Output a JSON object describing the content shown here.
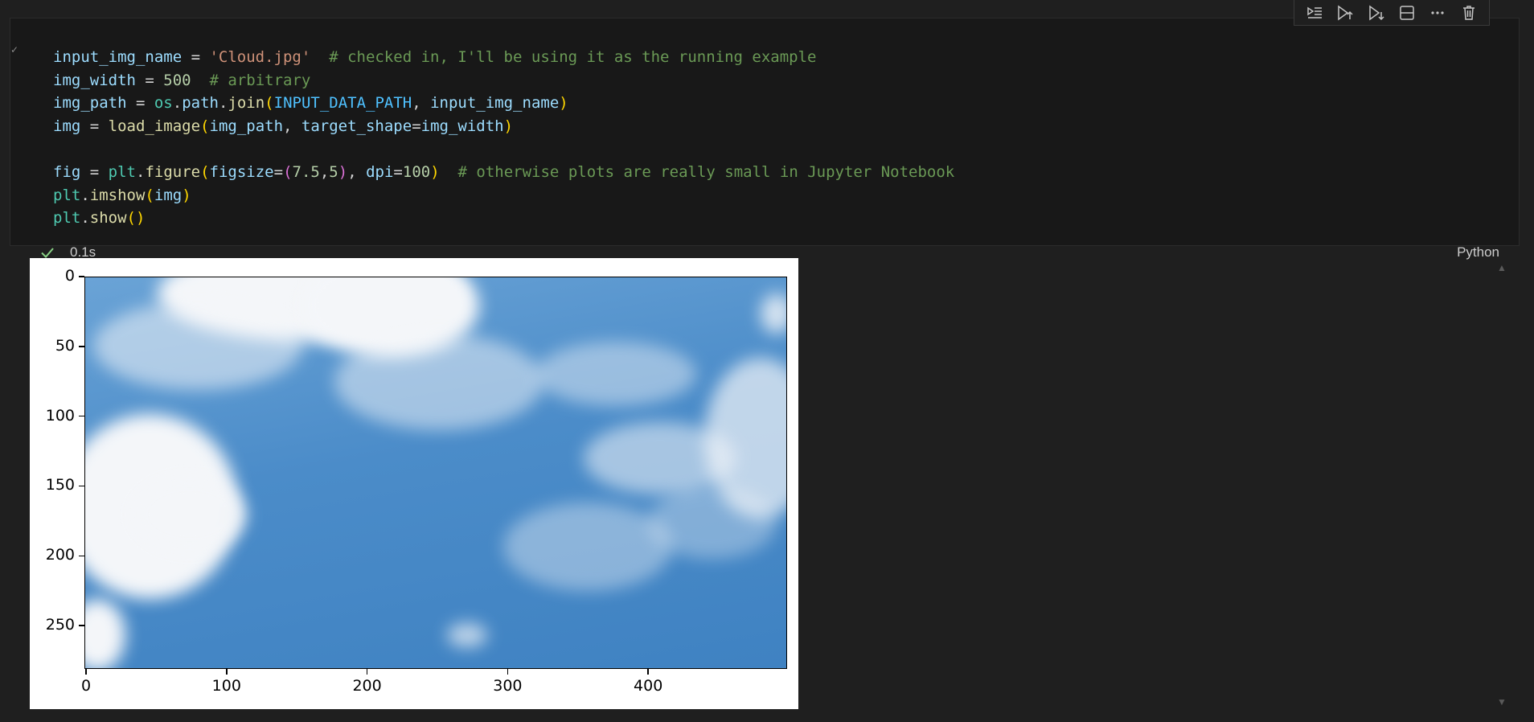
{
  "cell": {
    "code_lines": [
      {
        "tokens": [
          [
            "v",
            "input_img_name"
          ],
          [
            "o",
            " = "
          ],
          [
            "s",
            "'Cloud.jpg'"
          ],
          [
            "o",
            "  "
          ],
          [
            "c",
            "# checked in, I'll be using it as the running example"
          ]
        ]
      },
      {
        "tokens": [
          [
            "v",
            "img_width"
          ],
          [
            "o",
            " = "
          ],
          [
            "n",
            "500"
          ],
          [
            "o",
            "  "
          ],
          [
            "c",
            "# arbitrary"
          ]
        ]
      },
      {
        "tokens": [
          [
            "v",
            "img_path"
          ],
          [
            "o",
            " = "
          ],
          [
            "m",
            "os"
          ],
          [
            "o",
            "."
          ],
          [
            "v",
            "path"
          ],
          [
            "o",
            "."
          ],
          [
            "f",
            "join"
          ],
          [
            "p1",
            "("
          ],
          [
            "k",
            "INPUT_DATA_PATH"
          ],
          [
            "o",
            ", "
          ],
          [
            "v",
            "input_img_name"
          ],
          [
            "p1",
            ")"
          ]
        ]
      },
      {
        "tokens": [
          [
            "v",
            "img"
          ],
          [
            "o",
            " = "
          ],
          [
            "f",
            "load_image"
          ],
          [
            "p1",
            "("
          ],
          [
            "v",
            "img_path"
          ],
          [
            "o",
            ", "
          ],
          [
            "v",
            "target_shape"
          ],
          [
            "o",
            "="
          ],
          [
            "v",
            "img_width"
          ],
          [
            "p1",
            ")"
          ]
        ]
      },
      {
        "tokens": []
      },
      {
        "tokens": [
          [
            "v",
            "fig"
          ],
          [
            "o",
            " = "
          ],
          [
            "m",
            "plt"
          ],
          [
            "o",
            "."
          ],
          [
            "f",
            "figure"
          ],
          [
            "p1",
            "("
          ],
          [
            "v",
            "figsize"
          ],
          [
            "o",
            "="
          ],
          [
            "p2",
            "("
          ],
          [
            "n",
            "7.5"
          ],
          [
            "o",
            ","
          ],
          [
            "n",
            "5"
          ],
          [
            "p2",
            ")"
          ],
          [
            "o",
            ", "
          ],
          [
            "v",
            "dpi"
          ],
          [
            "o",
            "="
          ],
          [
            "n",
            "100"
          ],
          [
            "p1",
            ")"
          ],
          [
            "o",
            "  "
          ],
          [
            "c",
            "# otherwise plots are really small in Jupyter Notebook"
          ]
        ]
      },
      {
        "tokens": [
          [
            "m",
            "plt"
          ],
          [
            "o",
            "."
          ],
          [
            "f",
            "imshow"
          ],
          [
            "p1",
            "("
          ],
          [
            "v",
            "img"
          ],
          [
            "p1",
            ")"
          ]
        ]
      },
      {
        "tokens": [
          [
            "m",
            "plt"
          ],
          [
            "o",
            "."
          ],
          [
            "f",
            "show"
          ],
          [
            "p1",
            "()"
          ]
        ]
      }
    ],
    "exec_time": "0.1s",
    "language": "Python",
    "status_icon": "check-icon"
  },
  "toolbar": {
    "buttons": [
      "run-by-line-icon",
      "execute-above-icon",
      "execute-below-icon",
      "split-cell-icon",
      "more-actions-icon",
      "delete-cell-icon"
    ]
  },
  "output": {
    "image_alt": "Cloud.jpg",
    "y_ticks": [
      "0",
      "50",
      "100",
      "150",
      "200",
      "250"
    ],
    "x_ticks": [
      "0",
      "100",
      "200",
      "300",
      "400"
    ],
    "colors": {
      "sky": "#4b8cc9",
      "cloud": "#f4f6f9"
    }
  }
}
